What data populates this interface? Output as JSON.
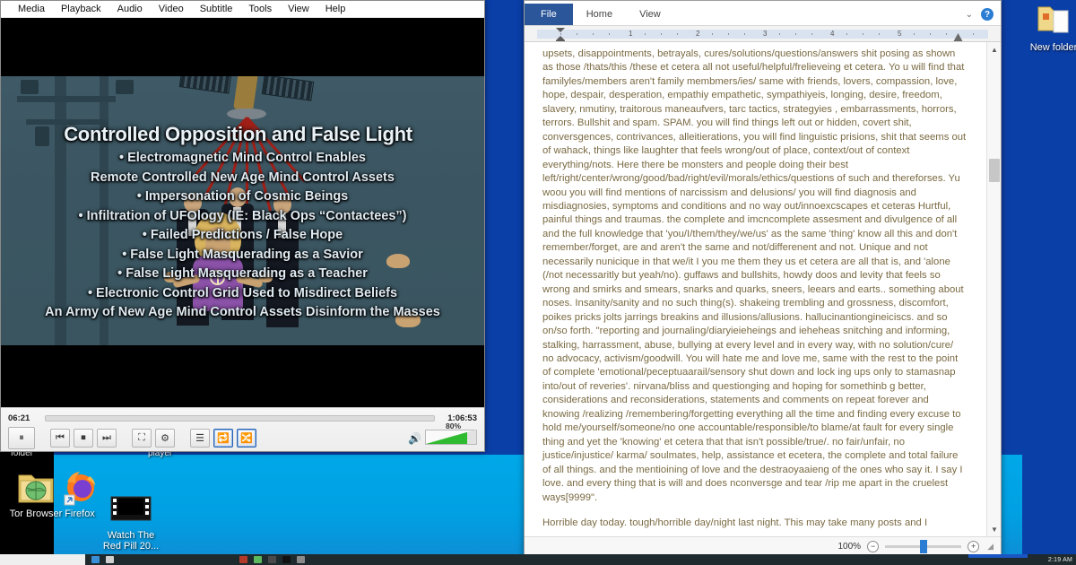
{
  "desktop": {
    "icons": [
      {
        "name": "tor-browser",
        "label": "Tor Browser",
        "glyph": "folder-globe-icon"
      },
      {
        "name": "firefox",
        "label": "Firefox",
        "glyph": "firefox-icon"
      },
      {
        "name": "watch-red-pill-video",
        "label": "Watch The\nRed Pill 20...",
        "glyph": "film-strip-icon"
      },
      {
        "name": "new-folder",
        "label": "New folder",
        "glyph": "folder-icon"
      }
    ],
    "partial_labels": {
      "left": "folder",
      "right": "player"
    },
    "colors": {
      "wallpaper_blue": "#0b3fa8",
      "wallpaper_cyan": "#00a8e8"
    }
  },
  "vlc": {
    "menu": [
      "Media",
      "Playback",
      "Audio",
      "Video",
      "Subtitle",
      "Tools",
      "View",
      "Help"
    ],
    "slide": {
      "title": "Controlled Opposition and False Light",
      "bullets": [
        "• Electromagnetic Mind Control Enables",
        "Remote Controlled New Age Mind Control Assets",
        "• Impersonation of Cosmic Beings",
        "• Infiltration of UFOlogy (IE: Black Ops “Contactees”)",
        "• Failed Predictions / False Hope",
        "• False Light Masquerading as a Savior",
        "• False Light Masquerading as a Teacher",
        "• Electronic Control Grid Used to Misdirect Beliefs",
        "An Army of New Age Mind Control Assets Disinform the Masses"
      ]
    },
    "transport": {
      "elapsed": "06:21",
      "total": "1:06:53",
      "progress_percent": 9.5,
      "volume_label": "80%",
      "volume_percent": 80
    },
    "buttons": {
      "play_pause": "⏸",
      "previous": "⏮",
      "stop": "⏹",
      "next": "⏭",
      "fullscreen": "⛶",
      "extended_settings": "⚙",
      "playlist": "☰",
      "loop": "🔁",
      "shuffle": "🔀"
    }
  },
  "word": {
    "tabs": [
      {
        "name": "file",
        "label": "File"
      },
      {
        "name": "home",
        "label": "Home"
      },
      {
        "name": "view",
        "label": "View"
      }
    ],
    "ribbon_right": {
      "collapse": "⌄",
      "help": "?"
    },
    "ruler_numbers": [
      "1",
      "2",
      "3",
      "4",
      "5"
    ],
    "status": {
      "zoom": "100%",
      "zoom_out": "−",
      "zoom_in": "+"
    },
    "document": {
      "paragraphs": [
        "upsets, disappointments, betrayals, cures/solutions/questions/answers shit posing as shown as those /thats/this /these et cetera all not useful/helpful/frelieveing et cetera. Yo u will find that familyles/members aren't family membmers/ies/ same with friends, lovers, compassion, love, hope, despair, desperation, empathiy empathetic, sympathiyeis, longing, desire, freedom, slavery, nmutiny, traitorous maneaufvers, tarc tactics, strategyies , embarrassments, horrors, terrors. Bullshit and spam. SPAM. you will find things left out or hidden, covert shit, conversgences, contrivances, alleitierations, you will find linguistic prisions, shit that seems out of wahack, things like laughter that feels wrong/out of place, context/out of context everything/nots. Here there be monsters and people doing their best left/right/center/wrong/good/bad/right/evil/morals/ethics/questions of such and thereforses. Yu woou  you will find mentions of narcissism and delusions/ you will find diagnosis and misdiagnosies, symptoms and conditions and no way out/innoexcscapes et ceteras Hurtful, painful things and traumas. the complete and imcncomplete assesment and divulgence of all and the full knowledge that 'you/I/them/they/we/us' as the same 'thing' know all this and don't remember/forget, are and aren't the same and not/differenent and not. Unique and not necessarily nunicique in that we/it I you me them they us et cetera are all that is, and 'alone (/not necessaritly but yeah/no). guffaws and bullshits, howdy doos and levity that feels so wrong and smirks and smears, snarks and quarks, sneers, leears and earts.. something about noses. Insanity/sanity and no such thing(s). shakeing trembling and grossness, discomfort, poikes pricks jolts jarrings breakins and illusions/allusions. hallucinantiongineiciscs. and so on/so forth. \"reporting and journaling/diaryieieheings and ieheheas snitching and informing, stalking, harrassment, abuse, bullying at every level and in every way, with no solution/cure/ no advocacy, activism/goodwill. You will hate me and love me, same with the rest to the point of complete 'emotional/peceptuaarail/sensory shut down and lock ing ups only to stamasnap into/out of reveries'. nirvana/bliss and questionging and hoping for somethinb g better, considerations and reconsiderations, statements and comments on repeat forever and knowing /realizing /remembering/forgetting everything all the time and finding every excuse to hold me/yourself/someone/no one accountable/responsible/to blame/at fault for every single thing and yet the 'knowing' et cetera that that isn't possible/true/. no fair/unfair, no justice/injustice/ karma/ soulmates, help, assistance et ecetera, the complete and total failure of all things. and the mentioining of love and the destraoyaaieng of the ones who say it. I say I love. and every thing that is will and does nconversge and tear /rip me apart in the cruelest ways[9999\".",
        "Horrible day today. tough/horrible day/night last night. This may take many posts and I"
      ]
    }
  },
  "taskbar": {
    "clock": "2:19 AM"
  }
}
